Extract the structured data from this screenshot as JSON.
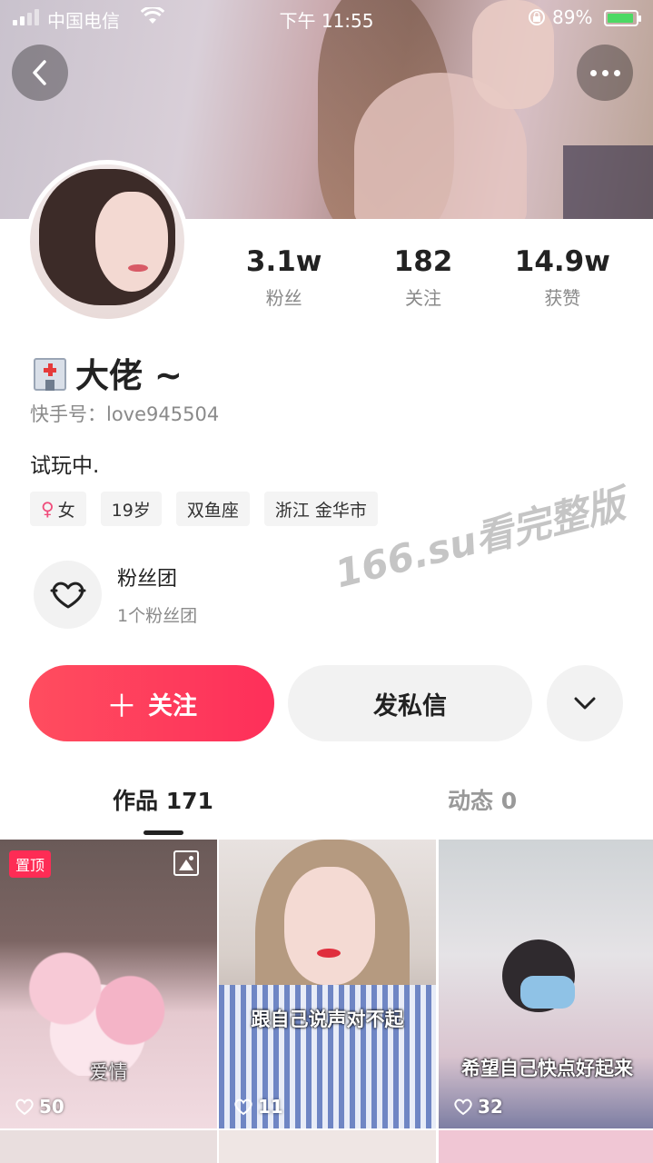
{
  "status_bar": {
    "carrier": "中国电信",
    "time": "下午 11:55",
    "battery": "89%"
  },
  "profile": {
    "stats": [
      {
        "value": "3.1w",
        "label": "粉丝"
      },
      {
        "value": "182",
        "label": "关注"
      },
      {
        "value": "14.9w",
        "label": "获赞"
      }
    ],
    "name": "大佬 ~",
    "user_id": "快手号：love945504",
    "bio": "试玩中.",
    "tags": {
      "gender": "女",
      "age": "19岁",
      "zodiac": "双鱼座",
      "location": "浙江 金华市"
    },
    "fan_club": {
      "title": "粉丝团",
      "subtitle": "1个粉丝团"
    }
  },
  "watermark": "166.su看完整版",
  "actions": {
    "follow_label": "关注",
    "message_label": "发私信"
  },
  "tabs": {
    "works": "作品 171",
    "moments": "动态 0"
  },
  "posts": [
    {
      "badge": "置顶",
      "caption": "爱情",
      "likes": "50"
    },
    {
      "caption": "跟自己说声对不起",
      "likes": "11"
    },
    {
      "caption": "希望自己快点好起来",
      "likes": "32"
    }
  ],
  "colors": {
    "accent": "#fe2c55",
    "muted_text": "#8a8a8a",
    "chip_bg": "#f4f4f4"
  }
}
